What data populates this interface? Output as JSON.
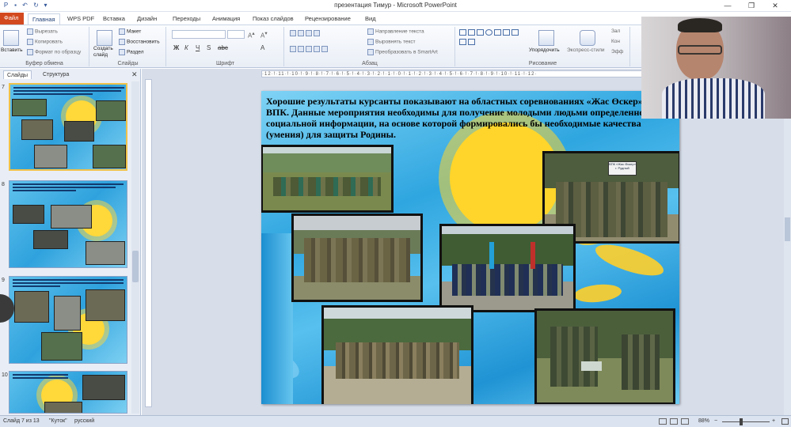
{
  "window": {
    "title": "презентация Тимур - Microsoft PowerPoint",
    "minimize": "—",
    "maximize": "❐",
    "close": "✕"
  },
  "tabs": [
    "Файл",
    "Главная",
    "WPS PDF",
    "Вставка",
    "Дизайн",
    "Переходы",
    "Анимация",
    "Показ слайдов",
    "Рецензирование",
    "Вид"
  ],
  "ribbon": {
    "clipboard": {
      "label": "Буфер обмена",
      "paste": "Вставить",
      "cut": "Вырезать",
      "copy": "Копировать",
      "format": "Формат по образцу"
    },
    "slides": {
      "label": "Слайды",
      "create": "Создать слайд",
      "layout": "Макет",
      "reset": "Восстановить",
      "section": "Раздел"
    },
    "font": {
      "label": "Шрифт"
    },
    "paragraph": {
      "label": "Абзац",
      "direction": "Направление текста",
      "align": "Выровнять текст",
      "smartart": "Преобразовать в SmartArt"
    },
    "drawing": {
      "label": "Рисование",
      "arrange": "Упорядочить",
      "styles": "Экспресс-стили"
    },
    "editing": {
      "fill": "Зал",
      "outline": "Кон",
      "effects": "Эфф"
    }
  },
  "left_panel": {
    "tabs": [
      "Слайды",
      "Структура"
    ],
    "slides": [
      {
        "num": "7",
        "selected": true
      },
      {
        "num": "8",
        "selected": false
      },
      {
        "num": "9",
        "selected": false
      },
      {
        "num": "10",
        "selected": false
      }
    ]
  },
  "slide": {
    "text": "Хорошие результаты  курсанты показывают на областных соревнованиях «Жас Өскер» среди ВПК. Данные мероприятия необходимы для  получение молодыми людьми определенной социальной информации, на основе которой формировались бы необходимые качества (умения) для защиты Родины.",
    "sign": "ВПК «Жас Өскер» г. Рудный"
  },
  "status": {
    "slide": "Слайд 7 из 13",
    "theme": "\"Куток\"",
    "lang": "русский",
    "zoom": "88%"
  },
  "colors": {
    "file_tab": "#d2491f",
    "slide_sky": "#2fa6e0",
    "sun": "#ffd52b"
  }
}
